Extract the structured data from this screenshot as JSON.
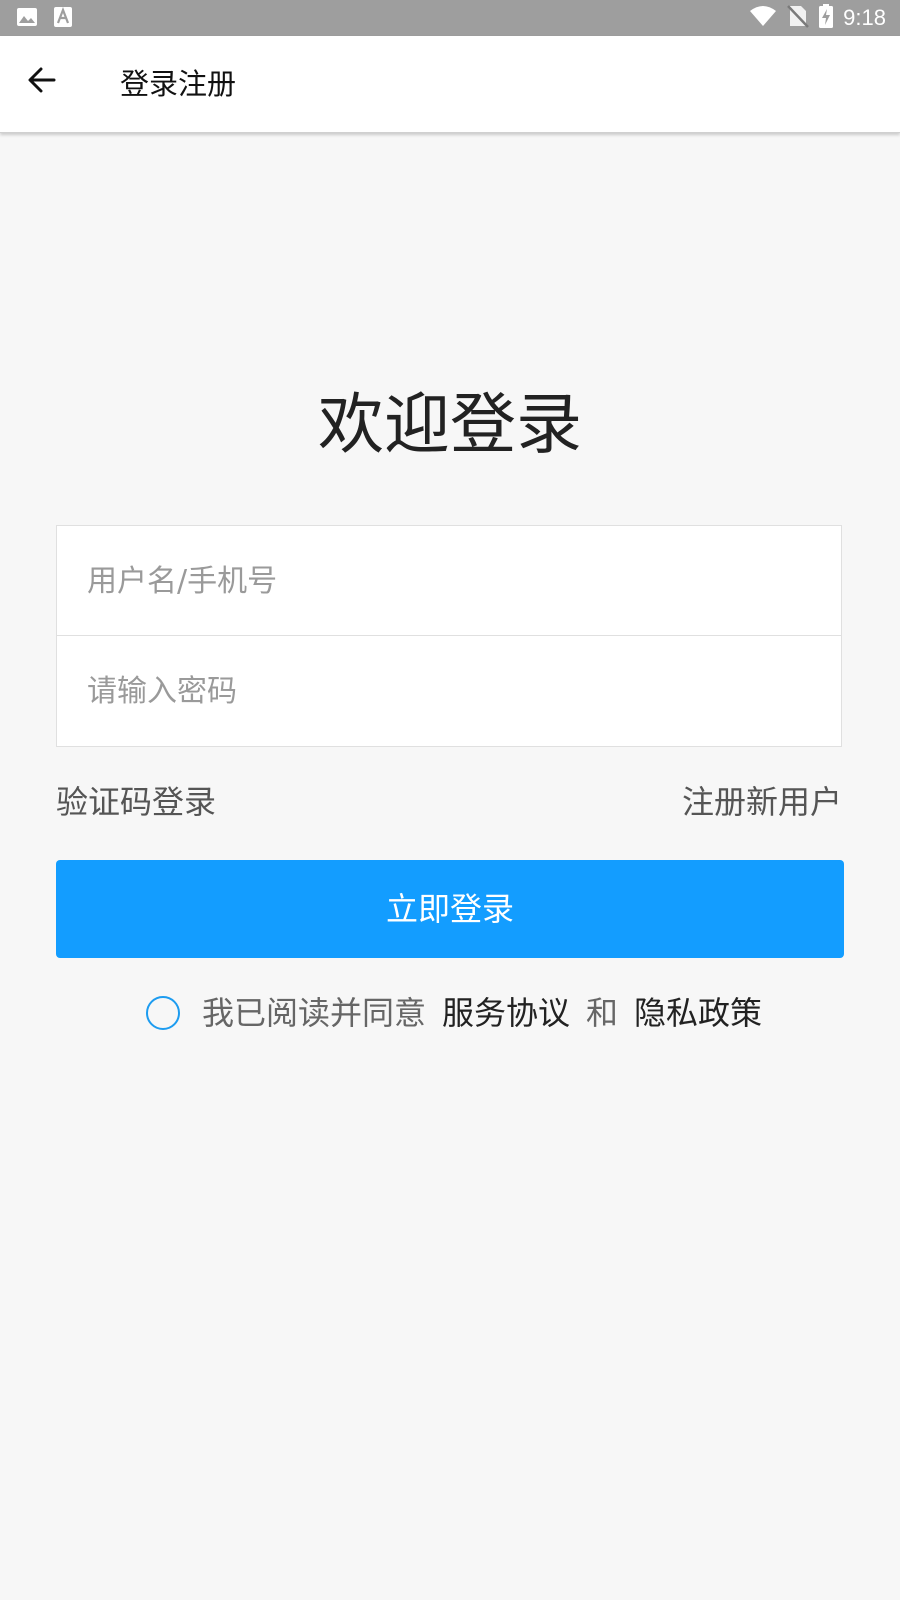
{
  "status_bar": {
    "time": "9:18",
    "left_icons": [
      "image-notification-icon",
      "text-notification-icon"
    ],
    "right_icons": [
      "wifi-icon",
      "no-sim-icon",
      "battery-charging-icon"
    ]
  },
  "app_bar": {
    "back_icon": "arrow-left-icon",
    "title": "登录注册"
  },
  "welcome": "欢迎登录",
  "form": {
    "username_placeholder": "用户名/手机号",
    "username_value": "",
    "password_placeholder": "请输入密码",
    "password_value": ""
  },
  "links": {
    "sms_login": "验证码登录",
    "register": "注册新用户"
  },
  "login_button": "立即登录",
  "agreement": {
    "checked": false,
    "prefix": "我已阅读并同意",
    "service": "服务协议",
    "and": "和",
    "privacy": "隐私政策"
  },
  "colors": {
    "accent": "#139dff",
    "background": "#f7f7f7",
    "status_bar": "#9e9e9e"
  }
}
